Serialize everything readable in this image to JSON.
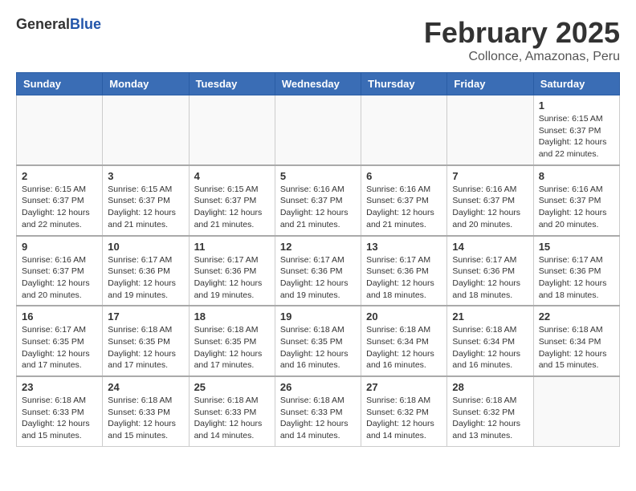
{
  "header": {
    "logo_general": "General",
    "logo_blue": "Blue",
    "title": "February 2025",
    "subtitle": "Collonce, Amazonas, Peru"
  },
  "days_of_week": [
    "Sunday",
    "Monday",
    "Tuesday",
    "Wednesday",
    "Thursday",
    "Friday",
    "Saturday"
  ],
  "weeks": [
    [
      {
        "day": "",
        "info": ""
      },
      {
        "day": "",
        "info": ""
      },
      {
        "day": "",
        "info": ""
      },
      {
        "day": "",
        "info": ""
      },
      {
        "day": "",
        "info": ""
      },
      {
        "day": "",
        "info": ""
      },
      {
        "day": "1",
        "info": "Sunrise: 6:15 AM\nSunset: 6:37 PM\nDaylight: 12 hours and 22 minutes."
      }
    ],
    [
      {
        "day": "2",
        "info": "Sunrise: 6:15 AM\nSunset: 6:37 PM\nDaylight: 12 hours and 22 minutes."
      },
      {
        "day": "3",
        "info": "Sunrise: 6:15 AM\nSunset: 6:37 PM\nDaylight: 12 hours and 21 minutes."
      },
      {
        "day": "4",
        "info": "Sunrise: 6:15 AM\nSunset: 6:37 PM\nDaylight: 12 hours and 21 minutes."
      },
      {
        "day": "5",
        "info": "Sunrise: 6:16 AM\nSunset: 6:37 PM\nDaylight: 12 hours and 21 minutes."
      },
      {
        "day": "6",
        "info": "Sunrise: 6:16 AM\nSunset: 6:37 PM\nDaylight: 12 hours and 21 minutes."
      },
      {
        "day": "7",
        "info": "Sunrise: 6:16 AM\nSunset: 6:37 PM\nDaylight: 12 hours and 20 minutes."
      },
      {
        "day": "8",
        "info": "Sunrise: 6:16 AM\nSunset: 6:37 PM\nDaylight: 12 hours and 20 minutes."
      }
    ],
    [
      {
        "day": "9",
        "info": "Sunrise: 6:16 AM\nSunset: 6:37 PM\nDaylight: 12 hours and 20 minutes."
      },
      {
        "day": "10",
        "info": "Sunrise: 6:17 AM\nSunset: 6:36 PM\nDaylight: 12 hours and 19 minutes."
      },
      {
        "day": "11",
        "info": "Sunrise: 6:17 AM\nSunset: 6:36 PM\nDaylight: 12 hours and 19 minutes."
      },
      {
        "day": "12",
        "info": "Sunrise: 6:17 AM\nSunset: 6:36 PM\nDaylight: 12 hours and 19 minutes."
      },
      {
        "day": "13",
        "info": "Sunrise: 6:17 AM\nSunset: 6:36 PM\nDaylight: 12 hours and 18 minutes."
      },
      {
        "day": "14",
        "info": "Sunrise: 6:17 AM\nSunset: 6:36 PM\nDaylight: 12 hours and 18 minutes."
      },
      {
        "day": "15",
        "info": "Sunrise: 6:17 AM\nSunset: 6:36 PM\nDaylight: 12 hours and 18 minutes."
      }
    ],
    [
      {
        "day": "16",
        "info": "Sunrise: 6:17 AM\nSunset: 6:35 PM\nDaylight: 12 hours and 17 minutes."
      },
      {
        "day": "17",
        "info": "Sunrise: 6:18 AM\nSunset: 6:35 PM\nDaylight: 12 hours and 17 minutes."
      },
      {
        "day": "18",
        "info": "Sunrise: 6:18 AM\nSunset: 6:35 PM\nDaylight: 12 hours and 17 minutes."
      },
      {
        "day": "19",
        "info": "Sunrise: 6:18 AM\nSunset: 6:35 PM\nDaylight: 12 hours and 16 minutes."
      },
      {
        "day": "20",
        "info": "Sunrise: 6:18 AM\nSunset: 6:34 PM\nDaylight: 12 hours and 16 minutes."
      },
      {
        "day": "21",
        "info": "Sunrise: 6:18 AM\nSunset: 6:34 PM\nDaylight: 12 hours and 16 minutes."
      },
      {
        "day": "22",
        "info": "Sunrise: 6:18 AM\nSunset: 6:34 PM\nDaylight: 12 hours and 15 minutes."
      }
    ],
    [
      {
        "day": "23",
        "info": "Sunrise: 6:18 AM\nSunset: 6:33 PM\nDaylight: 12 hours and 15 minutes."
      },
      {
        "day": "24",
        "info": "Sunrise: 6:18 AM\nSunset: 6:33 PM\nDaylight: 12 hours and 15 minutes."
      },
      {
        "day": "25",
        "info": "Sunrise: 6:18 AM\nSunset: 6:33 PM\nDaylight: 12 hours and 14 minutes."
      },
      {
        "day": "26",
        "info": "Sunrise: 6:18 AM\nSunset: 6:33 PM\nDaylight: 12 hours and 14 minutes."
      },
      {
        "day": "27",
        "info": "Sunrise: 6:18 AM\nSunset: 6:32 PM\nDaylight: 12 hours and 14 minutes."
      },
      {
        "day": "28",
        "info": "Sunrise: 6:18 AM\nSunset: 6:32 PM\nDaylight: 12 hours and 13 minutes."
      },
      {
        "day": "",
        "info": ""
      }
    ]
  ]
}
